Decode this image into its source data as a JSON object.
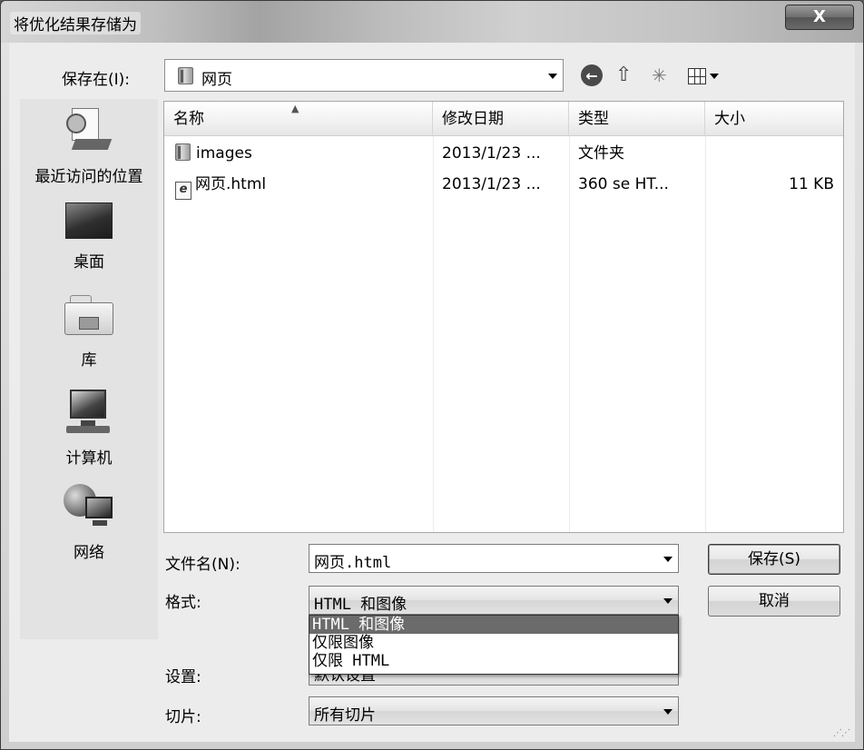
{
  "window": {
    "title": "将优化结果存储为",
    "close_glyph": "X"
  },
  "save_in": {
    "label": "保存在(I):",
    "value": "网页"
  },
  "places": [
    {
      "label": "最近访问的位置"
    },
    {
      "label": "桌面"
    },
    {
      "label": "库"
    },
    {
      "label": "计算机"
    },
    {
      "label": "网络"
    }
  ],
  "columns": {
    "name": "名称",
    "date": "修改日期",
    "type": "类型",
    "size": "大小"
  },
  "files": [
    {
      "name": "images",
      "date": "2013/1/23 ...",
      "type": "文件夹",
      "size": "",
      "icon": "folder-icon"
    },
    {
      "name": "网页.html",
      "date": "2013/1/23 ...",
      "type": "360 se HT...",
      "size": "11 KB",
      "icon": "html-file-icon"
    }
  ],
  "form": {
    "filename_label": "文件名(N):",
    "filename_value": "网页.html",
    "format_label": "格式:",
    "format_value": "HTML 和图像",
    "format_options": [
      "HTML 和图像",
      "仅限图像",
      "仅限 HTML"
    ],
    "settings_label": "设置:",
    "settings_value": "默认设置",
    "slices_label": "切片:",
    "slices_value": "所有切片"
  },
  "buttons": {
    "save": "保存(S)",
    "cancel": "取消"
  }
}
